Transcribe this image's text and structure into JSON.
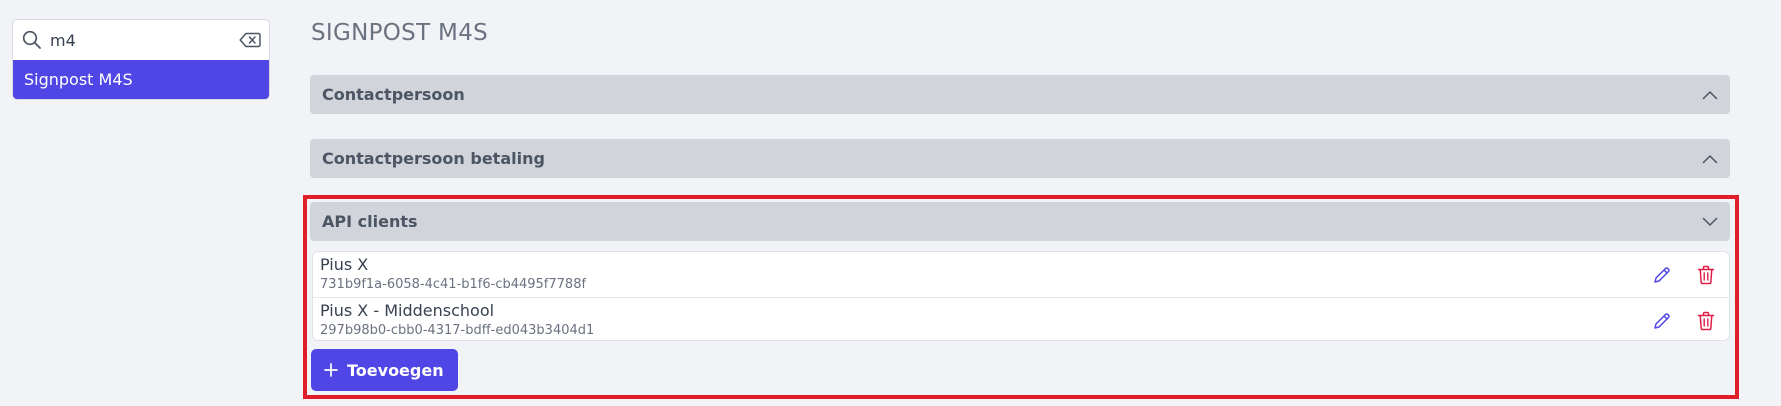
{
  "search": {
    "value": "m4",
    "icon": "search-icon",
    "clear_icon": "backspace-clear-icon"
  },
  "results": [
    {
      "label": "Signpost M4S",
      "selected": true
    }
  ],
  "page": {
    "title": "SIGNPOST M4S"
  },
  "sections": [
    {
      "title": "Contactpersoon",
      "expanded": false,
      "chevron": "chevron-up-icon"
    },
    {
      "title": "Contactpersoon betaling",
      "expanded": false,
      "chevron": "chevron-up-icon"
    },
    {
      "title": "API clients",
      "expanded": true,
      "chevron": "chevron-down-icon",
      "highlighted": true
    }
  ],
  "api_clients": [
    {
      "name": "Pius X",
      "id": "731b9f1a-6058-4c41-b1f6-cb4495f7788f"
    },
    {
      "name": "Pius X - Middenschool",
      "id": "297b98b0-cbb0-4317-bdff-ed043b3404d1"
    }
  ],
  "actions": {
    "add_label": "Toevoegen",
    "add_icon": "plus-icon",
    "edit_icon": "pencil-icon",
    "delete_icon": "trash-icon"
  },
  "colors": {
    "accent": "#4f46e5",
    "highlight": "#e11d2a",
    "delete": "#e11d48",
    "section_header": "#d1d4db",
    "background": "#f2f3f6"
  }
}
